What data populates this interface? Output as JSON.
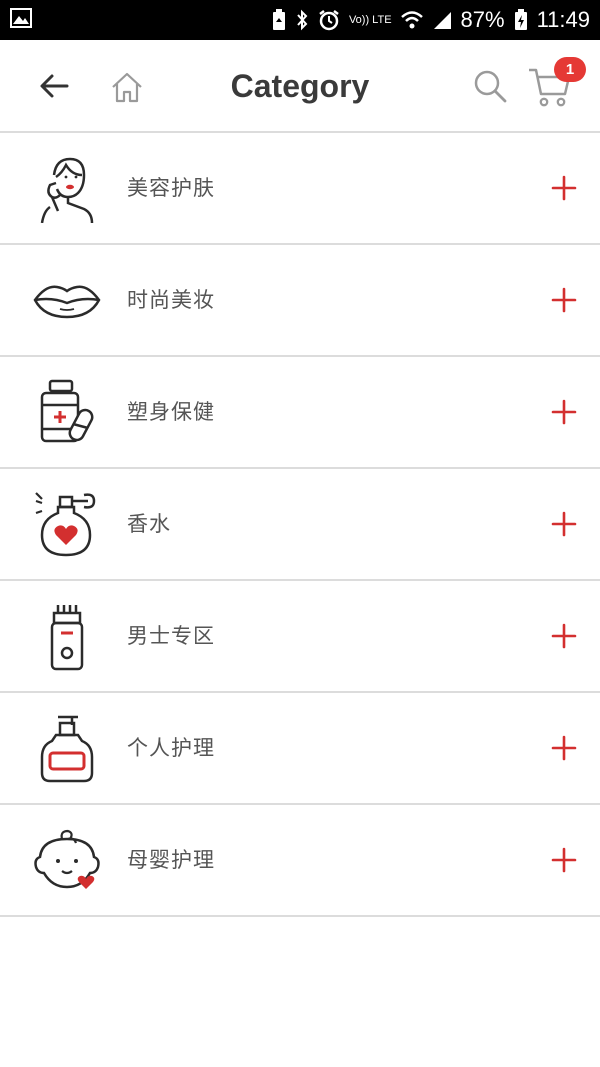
{
  "status_bar": {
    "left_icon": "gallery-icon",
    "battery_percent": "87%",
    "time": "11:49",
    "volte": "Vo)) LTE"
  },
  "header": {
    "title": "Category",
    "back_icon": "arrow-left-icon",
    "home_icon": "home-icon",
    "search_icon": "search-icon",
    "cart_icon": "cart-icon",
    "cart_badge": "1"
  },
  "categories": [
    {
      "label": "美容护肤",
      "icon": "woman-face-icon"
    },
    {
      "label": "时尚美妆",
      "icon": "lips-icon"
    },
    {
      "label": "塑身保健",
      "icon": "medicine-bottle-icon"
    },
    {
      "label": "香水",
      "icon": "perfume-icon"
    },
    {
      "label": "男士专区",
      "icon": "shaver-icon"
    },
    {
      "label": "个人护理",
      "icon": "lotion-bottle-icon"
    },
    {
      "label": "母婴护理",
      "icon": "baby-face-icon"
    }
  ],
  "colors": {
    "accent": "#d32f2f",
    "badge": "#e53935",
    "divider": "#dcdcdc",
    "text": "#555555",
    "title": "#3a3a3a",
    "icon_stroke": "#2b2b2b"
  }
}
